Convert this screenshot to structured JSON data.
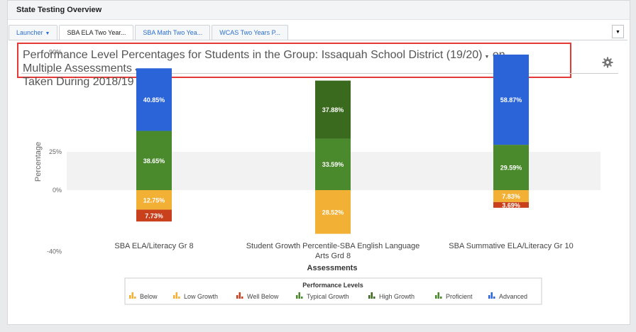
{
  "panel": {
    "title": "State Testing Overview"
  },
  "tabs": [
    {
      "label": "Launcher",
      "has_caret": true
    },
    {
      "label": "SBA ELA Two Year..."
    },
    {
      "label": "SBA Math Two Yea..."
    },
    {
      "label": "WCAS Two Years P..."
    }
  ],
  "header": {
    "part1": "Performance Level Percentages for Students in the Group:",
    "group": "Issaquah School District (19/20)",
    "part2": "on",
    "assessments": "Multiple Assessments",
    "part3": "Taken During",
    "year": "2018/19"
  },
  "icons": {
    "gear": "gear-icon",
    "caret": "caret-down-icon"
  },
  "chart_data": {
    "type": "bar",
    "stacked": true,
    "ylabel": "Percentage",
    "xlabel": "Assessments",
    "ytick_labels": [
      "90%",
      "25%",
      "0%",
      "-40%"
    ],
    "ylim": [
      -40,
      90
    ],
    "categories": [
      "SBA ELA/Literacy Gr 8",
      "Student Growth Percentile-SBA English Language Arts Grd 8",
      "SBA Summative ELA/Literacy Gr 10"
    ],
    "series": [
      {
        "name": "Below",
        "color": "#f2b035",
        "values": [
          -12.75,
          null,
          -7.83
        ]
      },
      {
        "name": "Low Growth",
        "color": "#f2b035",
        "values": [
          null,
          -28.52,
          null
        ]
      },
      {
        "name": "Well Below",
        "color": "#c8401c",
        "values": [
          -7.73,
          null,
          -3.69
        ]
      },
      {
        "name": "Typical Growth",
        "color": "#4a8a2c",
        "values": [
          null,
          33.59,
          null
        ]
      },
      {
        "name": "High Growth",
        "color": "#3a6a1e",
        "values": [
          null,
          37.88,
          null
        ]
      },
      {
        "name": "Proficient",
        "color": "#4a8a2c",
        "values": [
          38.65,
          null,
          29.59
        ]
      },
      {
        "name": "Advanced",
        "color": "#2b64d8",
        "values": [
          40.85,
          null,
          58.87
        ]
      }
    ],
    "data_labels": [
      [
        "12.75%",
        "7.73%",
        "38.65%",
        "40.85%"
      ],
      [
        "28.52%",
        "33.59%",
        "37.88%"
      ],
      [
        "7.83%",
        "3.69%",
        "29.59%",
        "58.87%"
      ]
    ],
    "legend": {
      "title": "Performance Levels",
      "position": "bottom"
    },
    "colors": {
      "Below": "#f2b035",
      "Low Growth": "#f2b035",
      "Well Below": "#c8401c",
      "Typical Growth": "#4a8a2c",
      "High Growth": "#3a6a1e",
      "Proficient": "#4a8a2c",
      "Advanced": "#2b64d8"
    },
    "band": [
      0,
      25
    ]
  }
}
